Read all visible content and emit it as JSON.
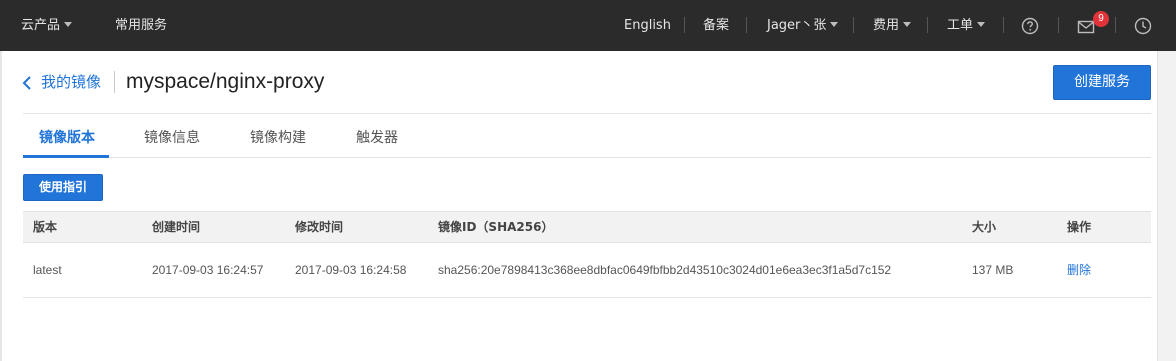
{
  "topbar": {
    "products": "云产品",
    "services": "常用服务",
    "language": "English",
    "record": "备案",
    "user": "Jager丶张",
    "billing": "费用",
    "tickets": "工单",
    "message_count": "9"
  },
  "breadcrumb": {
    "parent": "我的镜像",
    "title": "myspace/nginx-proxy"
  },
  "create_button": "创建服务",
  "tabs": [
    {
      "label": "镜像版本",
      "active": true
    },
    {
      "label": "镜像信息",
      "active": false
    },
    {
      "label": "镜像构建",
      "active": false
    },
    {
      "label": "触发器",
      "active": false
    }
  ],
  "guide_button": "使用指引",
  "table": {
    "columns": [
      "版本",
      "创建时间",
      "修改时间",
      "镜像ID（SHA256）",
      "大小",
      "操作"
    ],
    "rows": [
      {
        "version": "latest",
        "created": "2017-09-03 16:24:57",
        "modified": "2017-09-03 16:24:58",
        "image_id": "sha256:20e7898413c368ee8dbfac0649fbfbb2d43510c3024d01e6ea3ec3f1a5d7c152",
        "size": "137 MB",
        "action": "删除"
      }
    ]
  },
  "icons": {
    "help": "help-circle-icon",
    "mail": "mail-icon",
    "history": "clock-icon",
    "back": "chevron-left-icon"
  },
  "colors": {
    "topbar": "#2b2b2b",
    "accent": "#2174d8",
    "badge": "#e0343a"
  }
}
